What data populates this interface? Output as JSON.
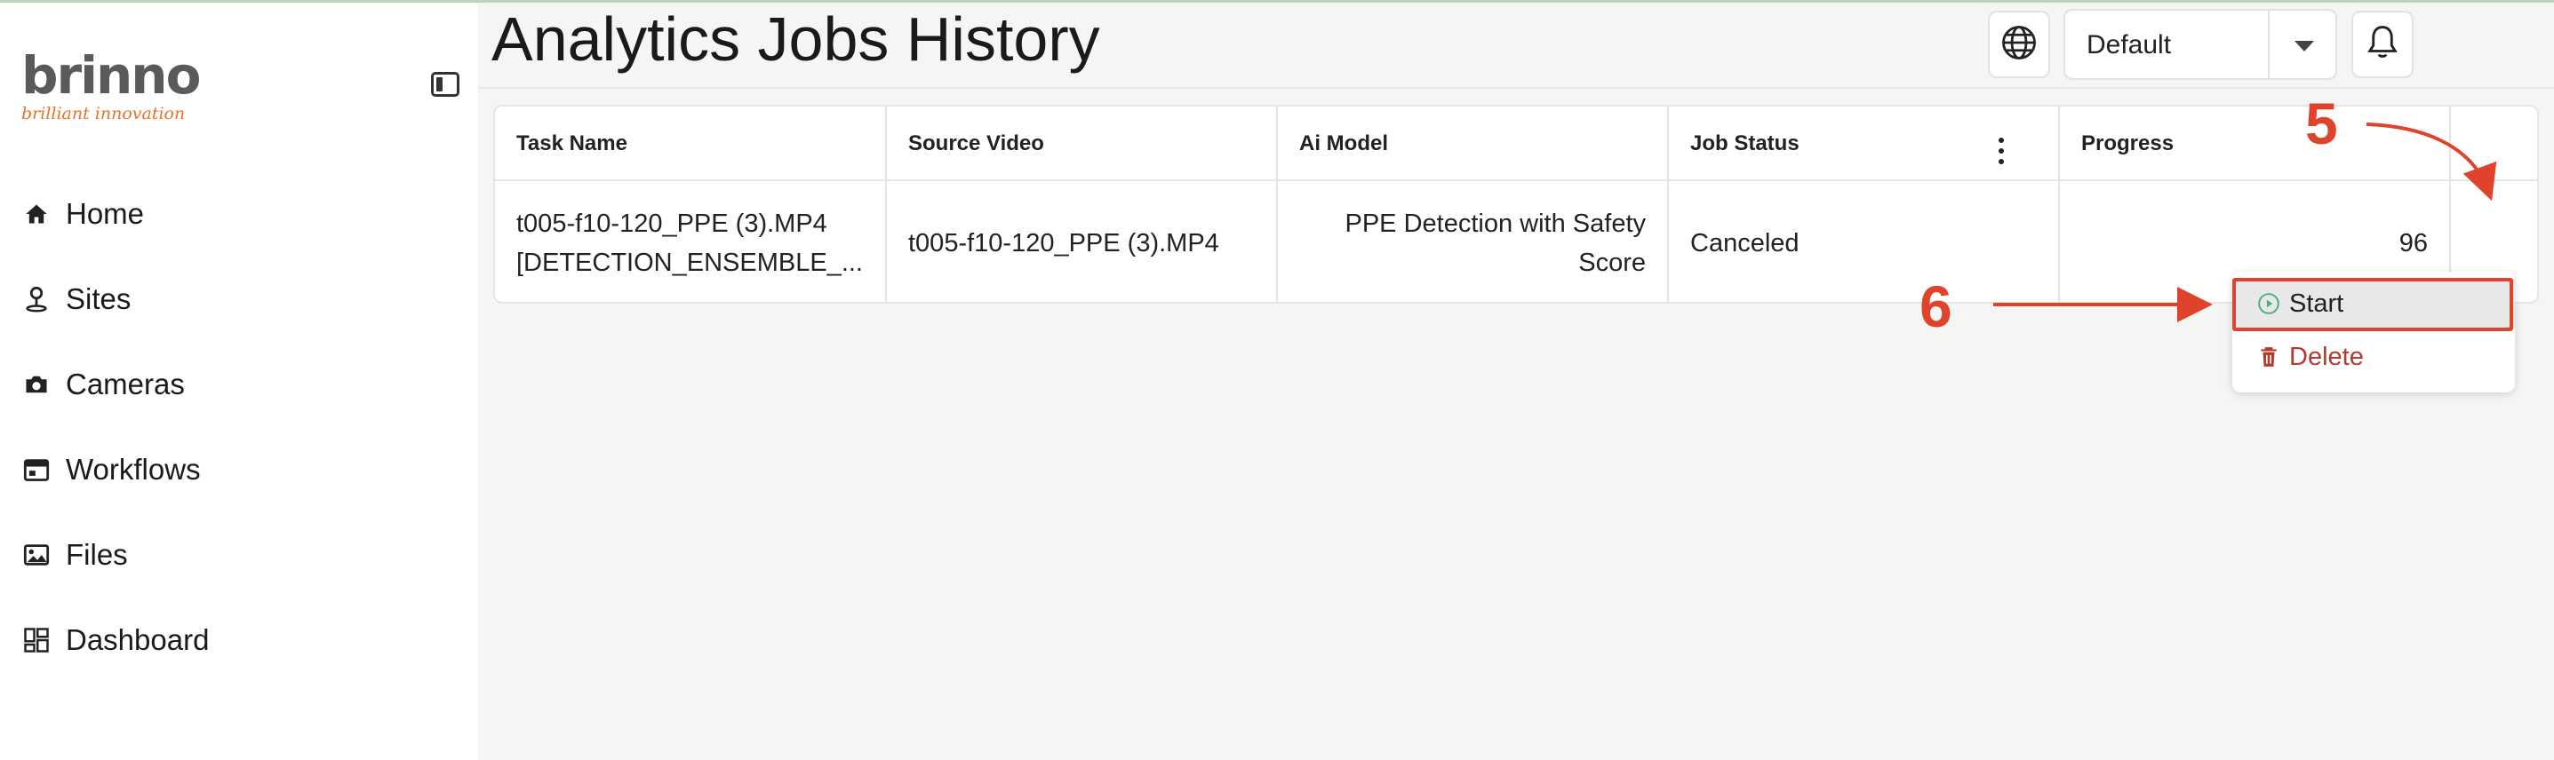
{
  "brand": {
    "name": "brinno",
    "tagline": "brilliant innovation",
    "accent": "#e8742a"
  },
  "sidebar": {
    "items": [
      {
        "label": "Home",
        "icon": "home-icon"
      },
      {
        "label": "Sites",
        "icon": "map-pin-person-icon"
      },
      {
        "label": "Cameras",
        "icon": "camera-icon"
      },
      {
        "label": "Workflows",
        "icon": "calendar-icon"
      },
      {
        "label": "Files",
        "icon": "image-icon"
      },
      {
        "label": "Dashboard",
        "icon": "dashboard-icon"
      }
    ]
  },
  "header": {
    "title": "Analytics Jobs History",
    "selector_value": "Default"
  },
  "table": {
    "columns": [
      "Task Name",
      "Source Video",
      "Ai Model",
      "Job Status",
      "Progress"
    ],
    "rows": [
      {
        "task_name_line1": "t005-f10-120_PPE (3).MP4",
        "task_name_line2": "[DETECTION_ENSEMBLE_...",
        "source_video": "t005-f10-120_PPE (3).MP4",
        "ai_model_line1": "PPE Detection with Safety",
        "ai_model_line2": "Score",
        "job_status": "Canceled",
        "progress": "96"
      }
    ]
  },
  "row_menu": {
    "items": [
      {
        "label": "Start",
        "icon": "play-circle-icon"
      },
      {
        "label": "Delete",
        "icon": "trash-icon"
      }
    ]
  },
  "annotations": {
    "step5": "5",
    "step6": "6",
    "color": "#e0432b"
  }
}
